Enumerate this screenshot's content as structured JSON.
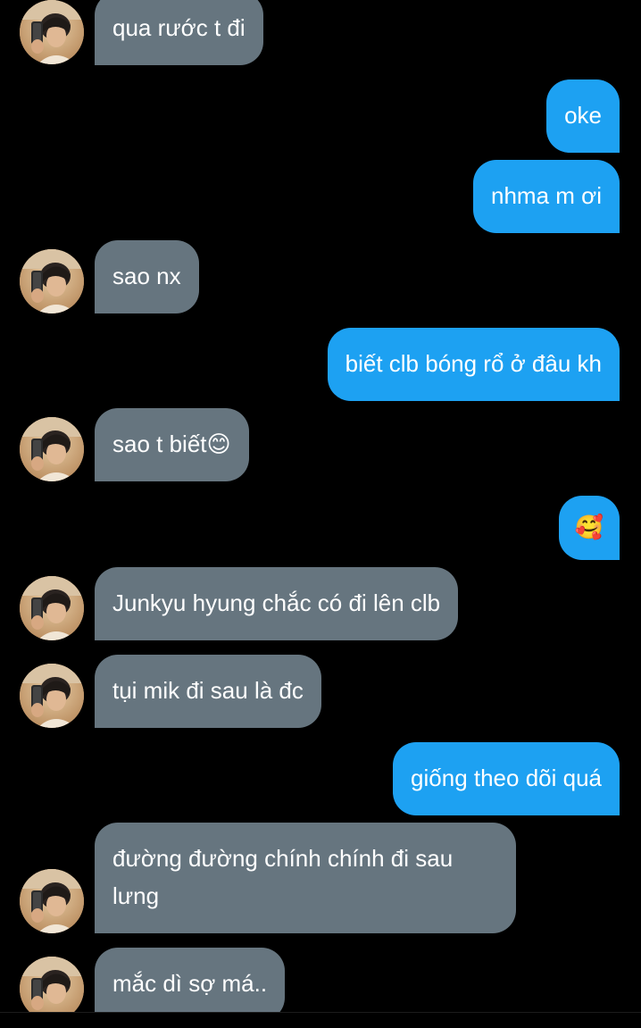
{
  "colors": {
    "background": "#000000",
    "incoming_bubble": "#66757f",
    "outgoing_bubble": "#1da1f2",
    "text": "#ffffff"
  },
  "messages": [
    {
      "direction": "incoming",
      "text": "qua rước t đi"
    },
    {
      "direction": "outgoing",
      "text": "oke"
    },
    {
      "direction": "outgoing",
      "text": "nhma m ơi"
    },
    {
      "direction": "incoming",
      "text": "sao nx"
    },
    {
      "direction": "outgoing",
      "text": "biết clb bóng rổ ở đâu kh"
    },
    {
      "direction": "incoming",
      "text": "sao t biết😊"
    },
    {
      "direction": "outgoing",
      "text": "🥰"
    },
    {
      "direction": "incoming",
      "text": "Junkyu hyung chắc có đi lên clb"
    },
    {
      "direction": "incoming",
      "text": "tụi mik đi sau là đc"
    },
    {
      "direction": "outgoing",
      "text": "giống theo dõi quá"
    },
    {
      "direction": "incoming",
      "text": "đường đường chính chính đi sau lưng"
    },
    {
      "direction": "incoming",
      "text": "mắc dì sợ má.."
    }
  ],
  "avatar_icon": "user-photo-avatar"
}
